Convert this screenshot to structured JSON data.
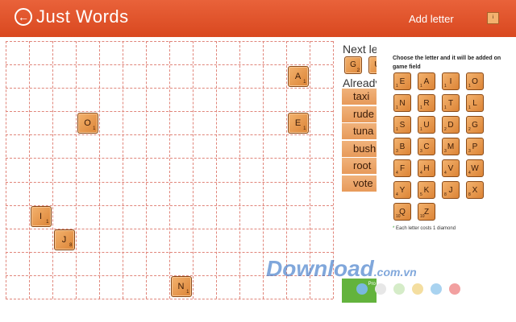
{
  "app": {
    "title": "Just Words",
    "back_icon": "back-arrow-icon"
  },
  "board": {
    "tiles": [
      {
        "letter": "A",
        "points": "1"
      },
      {
        "letter": "O",
        "points": "1"
      },
      {
        "letter": "E",
        "points": "1"
      },
      {
        "letter": "I",
        "points": "1"
      },
      {
        "letter": "J",
        "points": "8"
      },
      {
        "letter": "N",
        "points": "1"
      }
    ]
  },
  "sidebar": {
    "next_letters_label": "Next let",
    "next_tiles": [
      {
        "letter": "G",
        "points": "2"
      },
      {
        "letter": "U",
        "points": ""
      }
    ],
    "already_label": "Already",
    "words": [
      "taxi",
      "rude",
      "tuna",
      "bush",
      "root",
      "vote"
    ],
    "promo_label": "Pro"
  },
  "panel": {
    "title": "Add letter",
    "close_label": "i",
    "instruction": "Choose the letter and it will be added on game field",
    "keys": [
      {
        "letter": "E",
        "points": "1"
      },
      {
        "letter": "A",
        "points": "1"
      },
      {
        "letter": "I",
        "points": "1"
      },
      {
        "letter": "O",
        "points": "1"
      },
      {
        "letter": "N",
        "points": "1"
      },
      {
        "letter": "R",
        "points": "1"
      },
      {
        "letter": "T",
        "points": "1"
      },
      {
        "letter": "L",
        "points": "1"
      },
      {
        "letter": "S",
        "points": "1"
      },
      {
        "letter": "U",
        "points": "1"
      },
      {
        "letter": "D",
        "points": "2"
      },
      {
        "letter": "G",
        "points": "2"
      },
      {
        "letter": "B",
        "points": "3"
      },
      {
        "letter": "C",
        "points": "3"
      },
      {
        "letter": "M",
        "points": "3"
      },
      {
        "letter": "P",
        "points": "3"
      },
      {
        "letter": "F",
        "points": "4"
      },
      {
        "letter": "H",
        "points": "4"
      },
      {
        "letter": "V",
        "points": "4"
      },
      {
        "letter": "W",
        "points": "4"
      },
      {
        "letter": "Y",
        "points": "4"
      },
      {
        "letter": "K",
        "points": "5"
      },
      {
        "letter": "J",
        "points": "8"
      },
      {
        "letter": "X",
        "points": "8"
      },
      {
        "letter": "Q",
        "points": "10"
      },
      {
        "letter": "Z",
        "points": "10"
      }
    ],
    "note": "Each letter costs 1 diamond"
  },
  "watermark": {
    "main": "Download",
    "ext": ".com.vn"
  },
  "colors": {
    "accent": "#e05a2b",
    "tile": "#e39a52",
    "grid": "#e0857a",
    "promo": "#63b33d"
  },
  "dots": [
    "#7ab8e0",
    "#e7e7e7",
    "#d5ecc8",
    "#f4dea0",
    "#a9d3f0",
    "#f2a0a0"
  ]
}
